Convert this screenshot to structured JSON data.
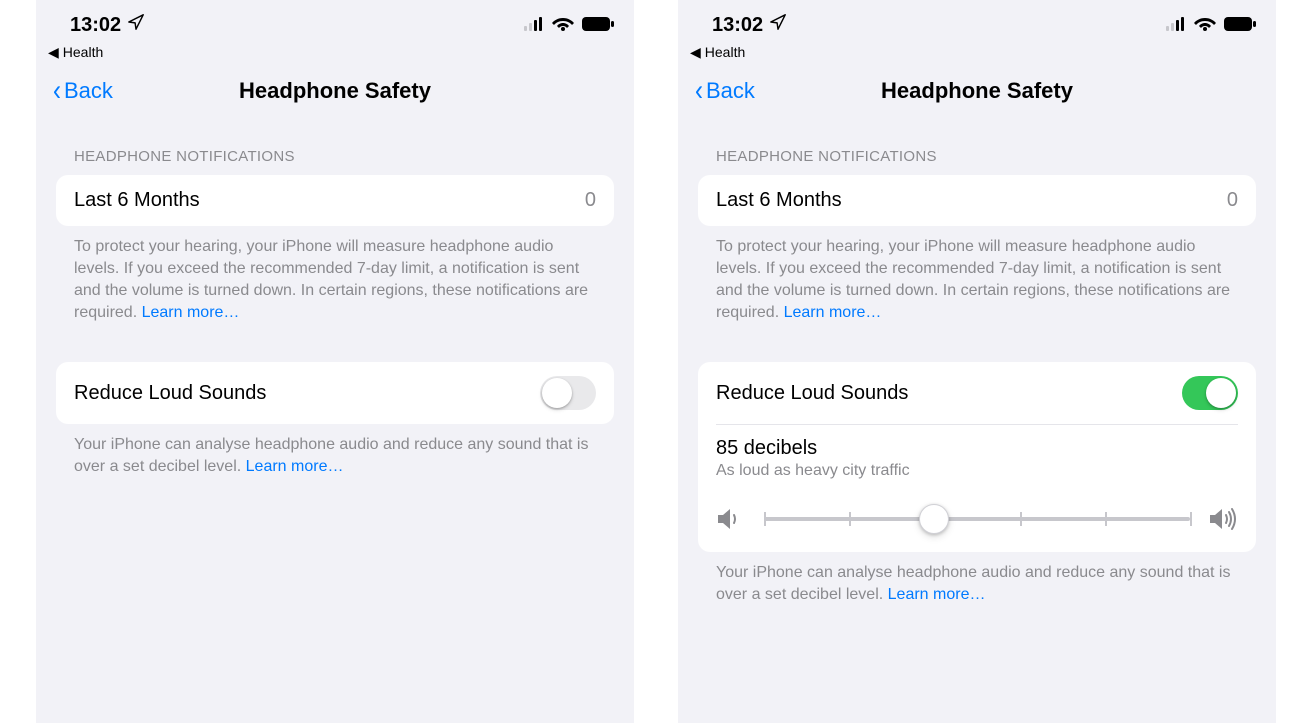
{
  "status": {
    "time": "13:02",
    "breadcrumb_app": "Health"
  },
  "nav": {
    "back": "Back",
    "title": "Headphone Safety"
  },
  "notifications": {
    "header": "HEADPHONE NOTIFICATIONS",
    "row_label": "Last 6 Months",
    "row_value": "0",
    "footer": "To protect your hearing, your iPhone will measure headphone audio levels. If you exceed the recommended 7-day limit, a notification is sent and the volume is turned down. In certain regions, these notifications are required. ",
    "learn_more": "Learn more…"
  },
  "reduce": {
    "label": "Reduce Loud Sounds",
    "footer": "Your iPhone can analyse headphone audio and reduce any sound that is over a set decibel level. ",
    "learn_more": "Learn more…"
  },
  "decibel": {
    "title": "85 decibels",
    "subtitle": "As loud as heavy city traffic",
    "min": 75,
    "max": 100,
    "value": 85,
    "ticks": [
      75,
      80,
      85,
      90,
      95,
      100
    ]
  },
  "screens": [
    {
      "reduce_on": false
    },
    {
      "reduce_on": true
    }
  ]
}
